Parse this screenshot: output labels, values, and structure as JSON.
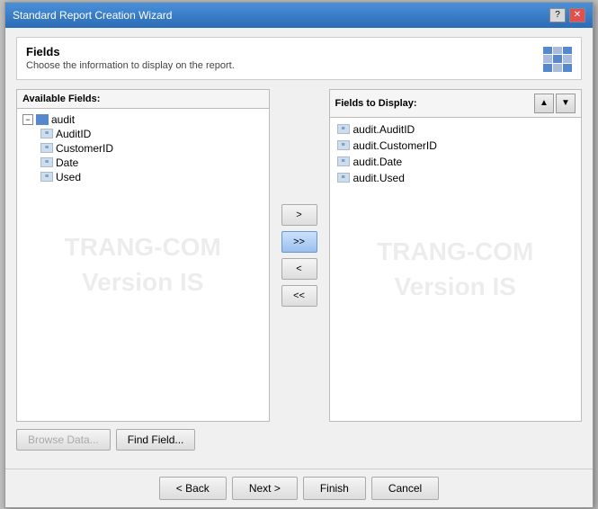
{
  "window": {
    "title": "Standard Report Creation Wizard",
    "titleBtns": [
      "?",
      "X"
    ]
  },
  "header": {
    "title": "Fields",
    "subtitle": "Choose the information to display on the report."
  },
  "availableFields": {
    "label": "Available Fields:",
    "tree": {
      "rootLabel": "audit",
      "children": [
        "AuditID",
        "CustomerID",
        "Date",
        "Used"
      ]
    }
  },
  "displayFields": {
    "label": "Fields to Display:",
    "items": [
      "audit.AuditID",
      "audit.CustomerID",
      "audit.Date",
      "audit.Used"
    ]
  },
  "middleButtons": {
    "add": ">",
    "addAll": ">>",
    "remove": "<",
    "removeAll": "<<"
  },
  "sortButtons": {
    "up": "▲",
    "down": "▼"
  },
  "bottomButtons": {
    "browse": "Browse Data...",
    "find": "Find Field..."
  },
  "footer": {
    "back": "< Back",
    "next": "Next >",
    "finish": "Finish",
    "cancel": "Cancel"
  },
  "watermark": {
    "line1": "TRANG-COM",
    "line2": "Version IS"
  }
}
